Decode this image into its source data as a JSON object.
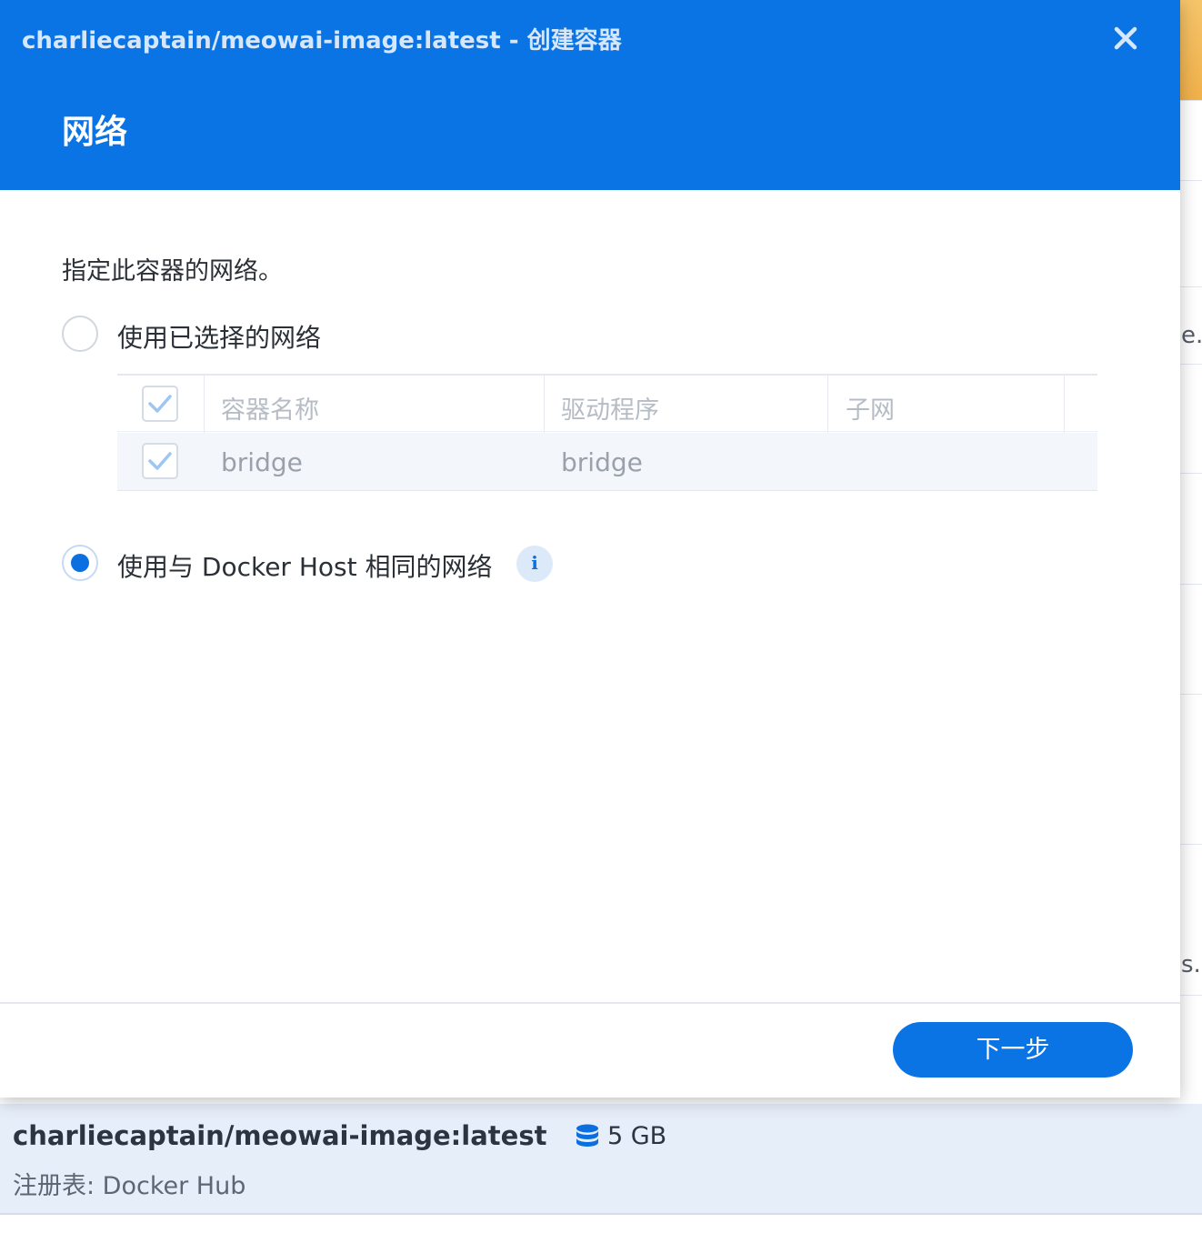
{
  "dialog": {
    "title": "charliecaptain/meowai-image:latest - 创建容器",
    "step_title": "网络",
    "description": "指定此容器的网络。",
    "options": [
      {
        "label": "使用已选择的网络",
        "selected": false
      },
      {
        "label": "使用与 Docker Host 相同的网络",
        "selected": true
      }
    ],
    "network_table": {
      "columns": [
        "容器名称",
        "驱动程序",
        "子网"
      ],
      "rows": [
        {
          "checked": true,
          "name": "bridge",
          "driver": "bridge",
          "subnet": ""
        }
      ]
    },
    "next_button": "下一步",
    "colors": {
      "header": "#0b74e5",
      "accent": "#0b6fe0"
    },
    "icons": {
      "close": "close-icon",
      "info": "info-icon"
    }
  },
  "background": {
    "image_name": "charliecaptain/meowai-image:latest",
    "size": "5 GB",
    "registry": "注册表: Docker Hub",
    "fragments": [
      "e.",
      "s."
    ],
    "icons": {
      "size": "database-icon"
    }
  }
}
